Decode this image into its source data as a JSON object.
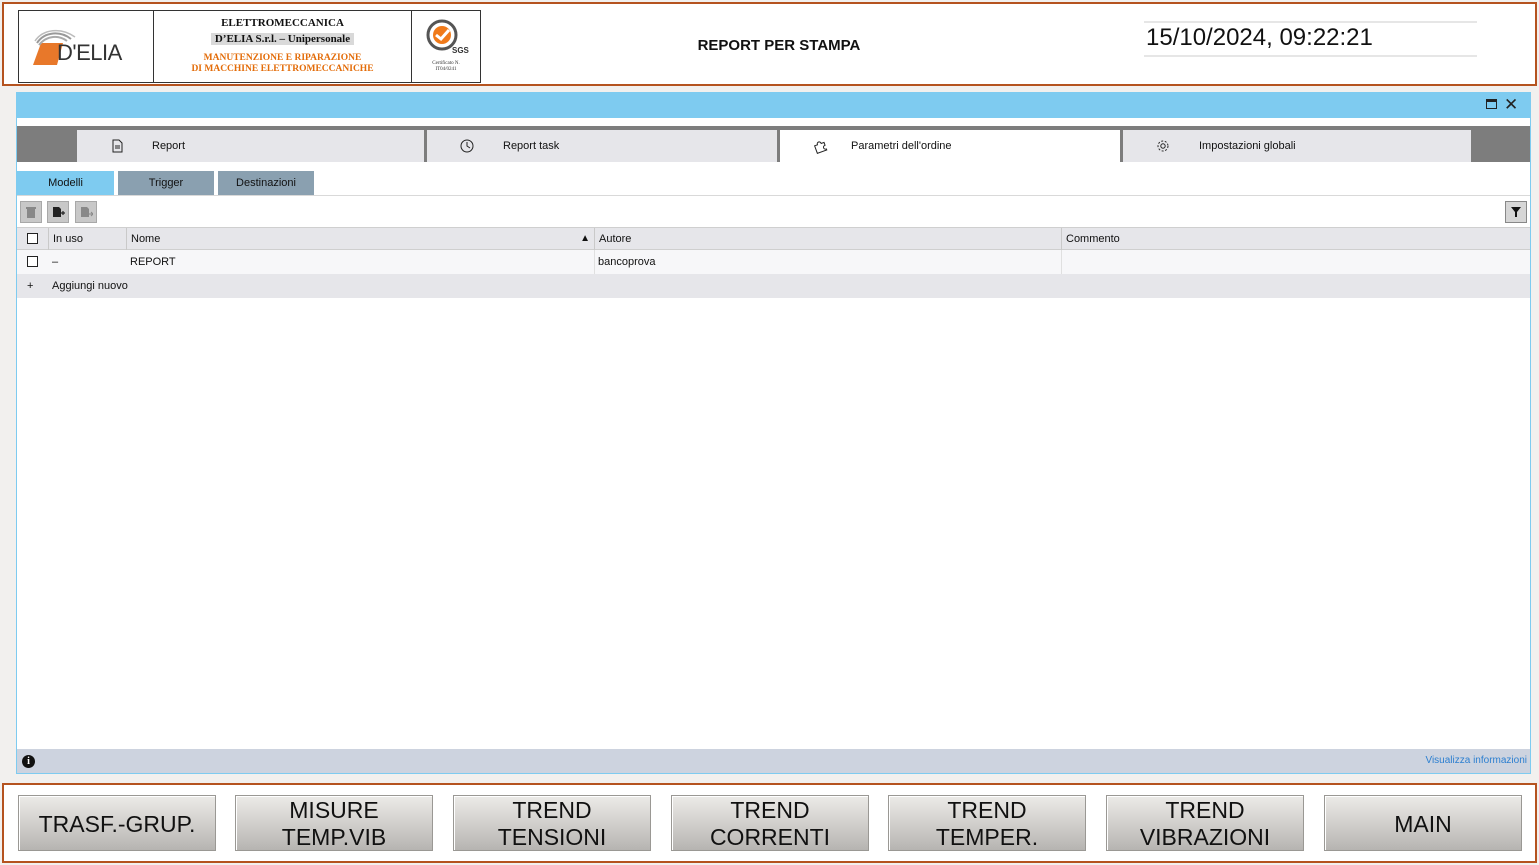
{
  "header": {
    "brand": "D'ELIA",
    "company_line1": "ELETTROMECCANICA",
    "company_line2": "D’ELIA S.r.l. – Unipersonale",
    "company_line3": "MANUTENZIONE E RIPARAZIONE",
    "company_line4": "DI MACCHINE ELETTROMECCANICHE",
    "cert_brand": "SGS",
    "cert_line1": "Certificato N.",
    "cert_line2": "IT04/0241",
    "title": "REPORT PER STAMPA",
    "datetime": "15/10/2024, 09:22:21"
  },
  "tabs": [
    {
      "label": "Report",
      "icon": "document-icon"
    },
    {
      "label": "Report task",
      "icon": "clock-icon"
    },
    {
      "label": "Parametri dell'ordine",
      "icon": "puzzle-icon",
      "active": true
    },
    {
      "label": "Impostazioni globali",
      "icon": "gear-icon"
    }
  ],
  "subtabs": [
    {
      "label": "Modelli",
      "active": true
    },
    {
      "label": "Trigger"
    },
    {
      "label": "Destinazioni"
    }
  ],
  "table": {
    "columns": [
      "In uso",
      "Nome",
      "Autore",
      "Commento"
    ],
    "sort_column": "Nome",
    "rows": [
      {
        "in_uso": "–",
        "nome": "REPORT",
        "autore": "bancoprova",
        "commento": ""
      }
    ],
    "add_new": "Aggiungi nuovo",
    "add_symbol": "+"
  },
  "status": {
    "info_link": "Visualizza informazioni"
  },
  "nav": [
    {
      "line1": "TRASF.-GRUP.",
      "line2": ""
    },
    {
      "line1": "MISURE",
      "line2": "TEMP.VIB"
    },
    {
      "line1": "TREND",
      "line2": "TENSIONI"
    },
    {
      "line1": "TREND",
      "line2": "CORRENTI"
    },
    {
      "line1": "TREND",
      "line2": "TEMPER."
    },
    {
      "line1": "TREND",
      "line2": "VIBRAZIONI"
    },
    {
      "line1": "MAIN",
      "line2": ""
    }
  ],
  "colors": {
    "frame": "#b5531f",
    "window_bar": "#7ecbf0",
    "accent_link": "#2c7fd0",
    "logo_orange": "#e36c09"
  }
}
